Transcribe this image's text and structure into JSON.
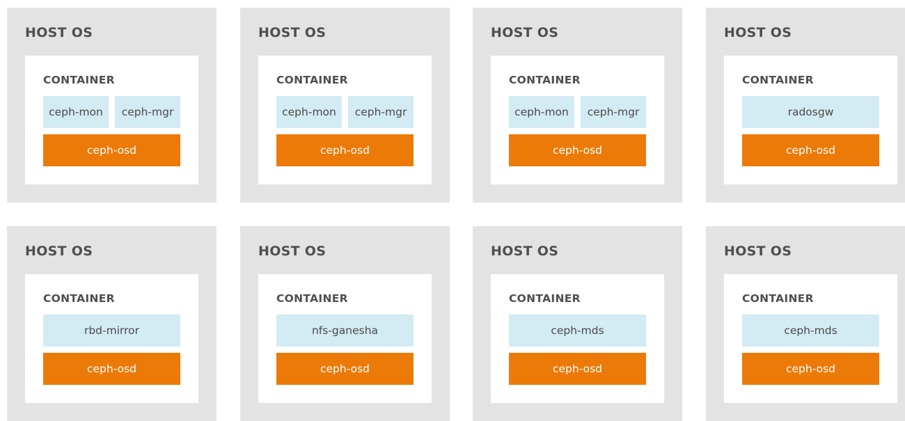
{
  "hosts": [
    {
      "label": "HOST OS",
      "container": {
        "label": "CONTAINER",
        "services": [
          "ceph-mon",
          "ceph-mgr"
        ],
        "osd": "ceph-osd"
      }
    },
    {
      "label": "HOST OS",
      "container": {
        "label": "CONTAINER",
        "services": [
          "ceph-mon",
          "ceph-mgr"
        ],
        "osd": "ceph-osd"
      }
    },
    {
      "label": "HOST OS",
      "container": {
        "label": "CONTAINER",
        "services": [
          "ceph-mon",
          "ceph-mgr"
        ],
        "osd": "ceph-osd"
      }
    },
    {
      "label": "HOST OS",
      "container": {
        "label": "CONTAINER",
        "services": [
          "radosgw"
        ],
        "osd": "ceph-osd"
      }
    },
    {
      "label": "HOST OS",
      "container": {
        "label": "CONTAINER",
        "services": [
          "rbd-mirror"
        ],
        "osd": "ceph-osd"
      }
    },
    {
      "label": "HOST OS",
      "container": {
        "label": "CONTAINER",
        "services": [
          "nfs-ganesha"
        ],
        "osd": "ceph-osd"
      }
    },
    {
      "label": "HOST OS",
      "container": {
        "label": "CONTAINER",
        "services": [
          "ceph-mds"
        ],
        "osd": "ceph-osd"
      }
    },
    {
      "label": "HOST OS",
      "container": {
        "label": "CONTAINER",
        "services": [
          "ceph-mds"
        ],
        "osd": "ceph-osd"
      }
    }
  ],
  "colors": {
    "host_background": "#e3e3e3",
    "container_background": "#ffffff",
    "service_background": "#d3ebf3",
    "osd_background": "#ec7a08",
    "label_text": "#4f4f4f",
    "osd_text": "#ffffff"
  }
}
